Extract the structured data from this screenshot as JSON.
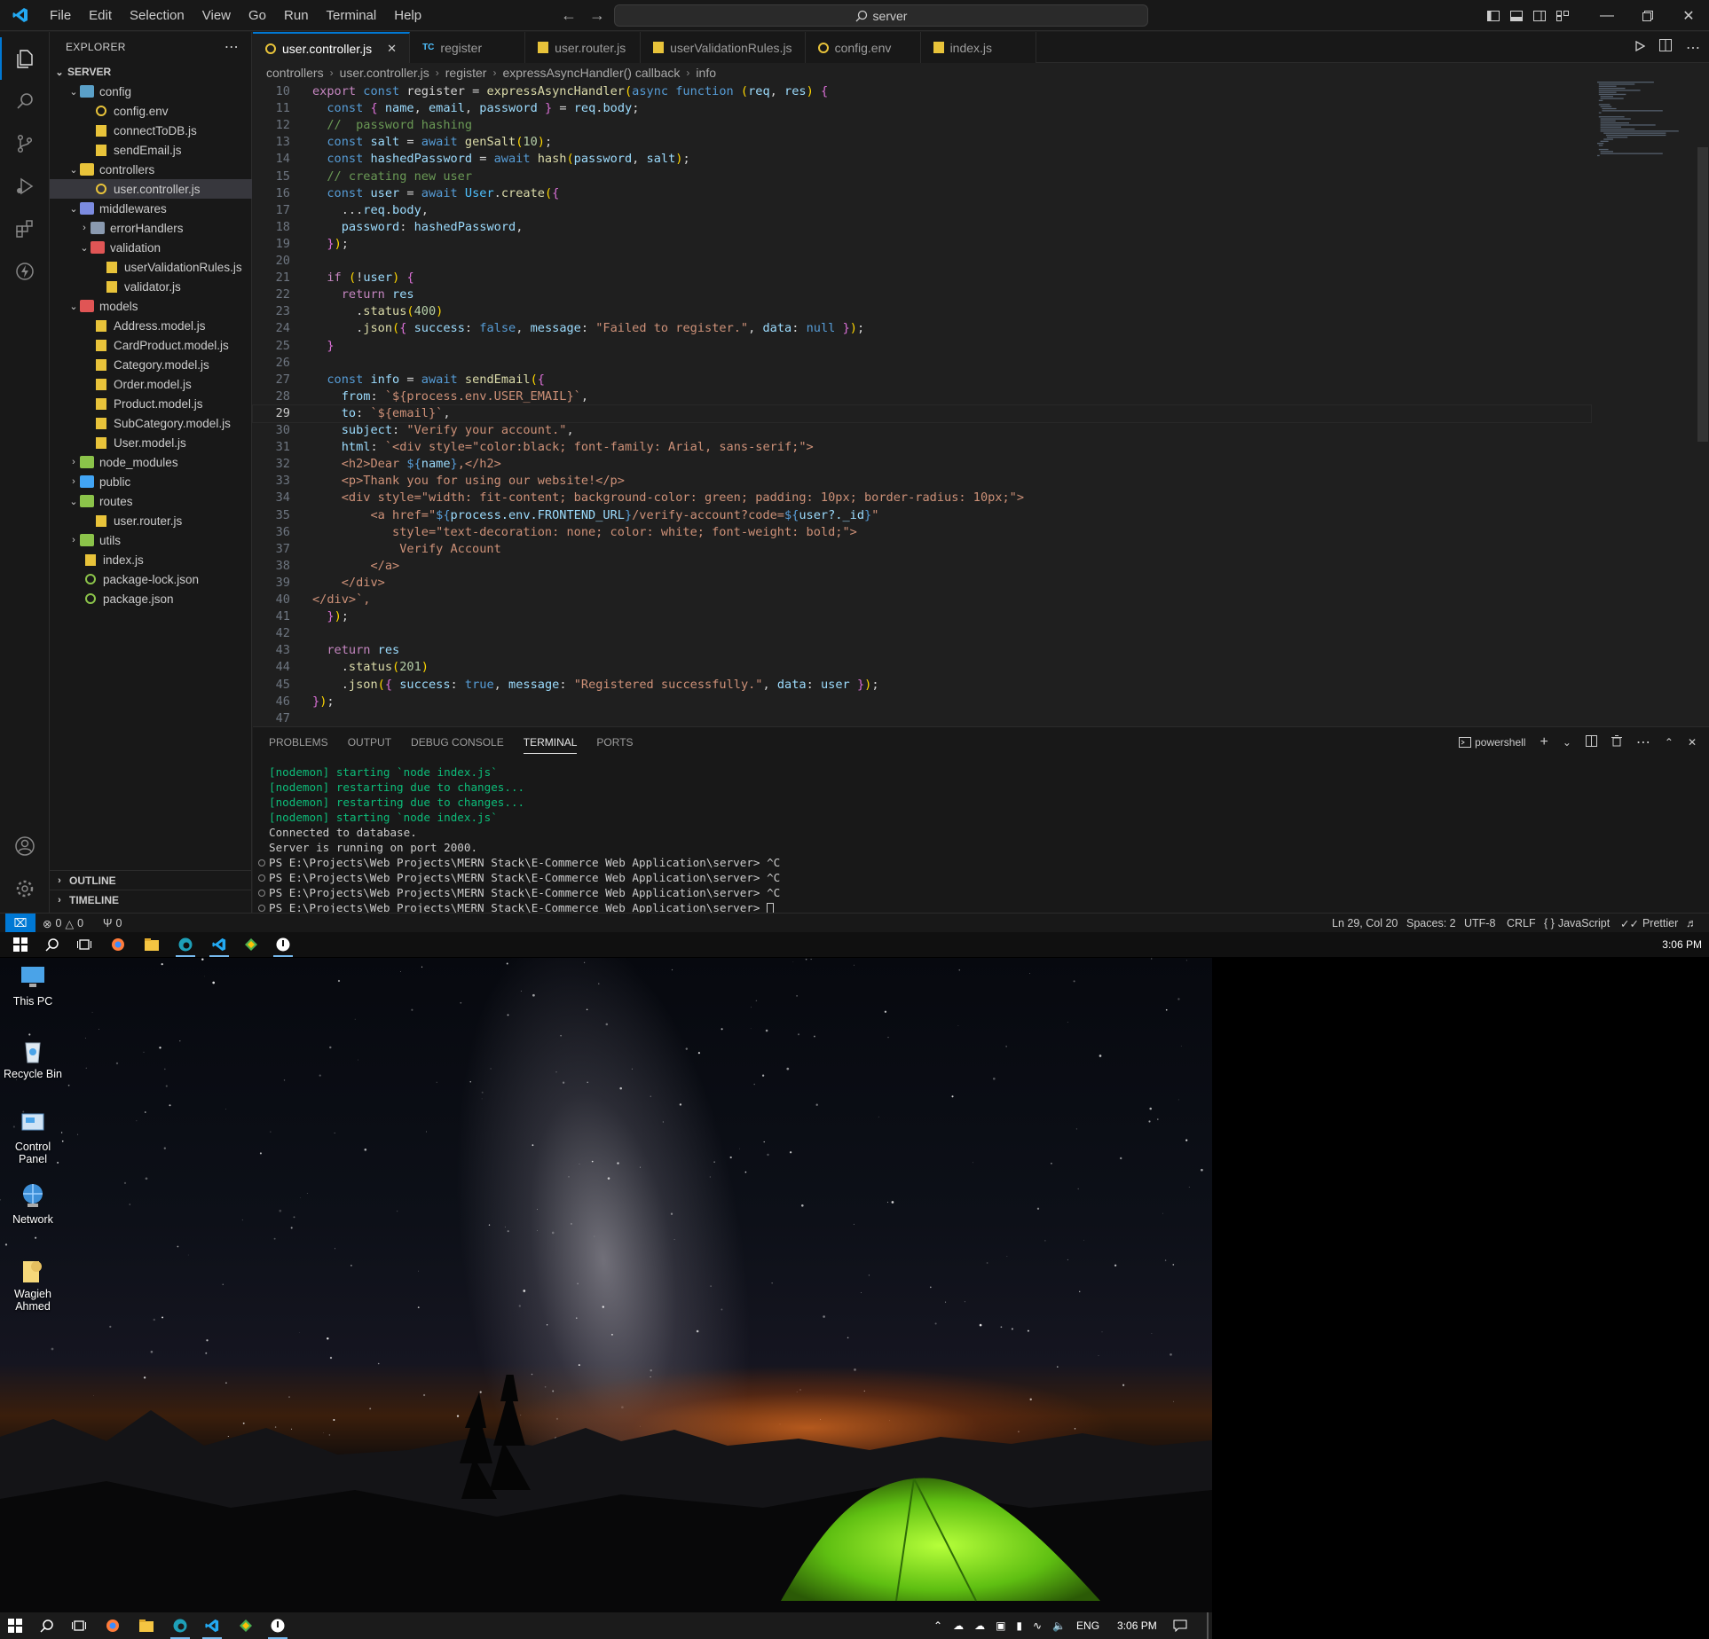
{
  "menu": [
    "File",
    "Edit",
    "Selection",
    "View",
    "Go",
    "Run",
    "Terminal",
    "Help"
  ],
  "command_center": "server",
  "explorer": {
    "title": "EXPLORER",
    "root": "SERVER",
    "tree": [
      {
        "label": "config",
        "type": "folder",
        "depth": 1,
        "open": true
      },
      {
        "label": "config.env",
        "type": "env",
        "depth": 2
      },
      {
        "label": "connectToDB.js",
        "type": "js",
        "depth": 2
      },
      {
        "label": "sendEmail.js",
        "type": "js",
        "depth": 2
      },
      {
        "label": "controllers",
        "type": "folder",
        "depth": 1,
        "open": true
      },
      {
        "label": "user.controller.js",
        "type": "gear",
        "depth": 2,
        "selected": true
      },
      {
        "label": "middlewares",
        "type": "folder",
        "depth": 1,
        "open": true
      },
      {
        "label": "errorHandlers",
        "type": "folder",
        "depth": 2,
        "open": false
      },
      {
        "label": "validation",
        "type": "folder",
        "depth": 2,
        "open": true
      },
      {
        "label": "userValidationRules.js",
        "type": "js",
        "depth": 3
      },
      {
        "label": "validator.js",
        "type": "js",
        "depth": 3
      },
      {
        "label": "models",
        "type": "folder",
        "depth": 1,
        "open": true
      },
      {
        "label": "Address.model.js",
        "type": "js",
        "depth": 2
      },
      {
        "label": "CardProduct.model.js",
        "type": "js",
        "depth": 2
      },
      {
        "label": "Category.model.js",
        "type": "js",
        "depth": 2
      },
      {
        "label": "Order.model.js",
        "type": "js",
        "depth": 2
      },
      {
        "label": "Product.model.js",
        "type": "js",
        "depth": 2
      },
      {
        "label": "SubCategory.model.js",
        "type": "js",
        "depth": 2
      },
      {
        "label": "User.model.js",
        "type": "js",
        "depth": 2
      },
      {
        "label": "node_modules",
        "type": "folder",
        "depth": 1,
        "open": false
      },
      {
        "label": "public",
        "type": "folder",
        "depth": 1,
        "open": false
      },
      {
        "label": "routes",
        "type": "folder",
        "depth": 1,
        "open": true
      },
      {
        "label": "user.router.js",
        "type": "js",
        "depth": 2
      },
      {
        "label": "utils",
        "type": "folder",
        "depth": 1,
        "open": false
      },
      {
        "label": "index.js",
        "type": "js",
        "depth": 1
      },
      {
        "label": "package-lock.json",
        "type": "json",
        "depth": 1
      },
      {
        "label": "package.json",
        "type": "json",
        "depth": 1
      }
    ],
    "outline": "OUTLINE",
    "timeline": "TIMELINE"
  },
  "tabs": [
    {
      "label": "user.controller.js",
      "icon": "gear",
      "active": true
    },
    {
      "label": "register",
      "icon": "TC"
    },
    {
      "label": "user.router.js",
      "icon": "js"
    },
    {
      "label": "userValidationRules.js",
      "icon": "js"
    },
    {
      "label": "config.env",
      "icon": "gear"
    },
    {
      "label": "index.js",
      "icon": "js"
    }
  ],
  "breadcrumbs": [
    "controllers",
    "user.controller.js",
    "register",
    "expressAsyncHandler() callback",
    "info"
  ],
  "code": {
    "first_line": 10,
    "current_line": 29,
    "lines": [
      "export const register = expressAsyncHandler(async function (req, res) {",
      "  const { name, email, password } = req.body;",
      "  //  password hashing",
      "  const salt = await genSalt(10);",
      "  const hashedPassword = await hash(password, salt);",
      "  // creating new user",
      "  const user = await User.create({",
      "    ...req.body,",
      "    password: hashedPassword,",
      "  });",
      "",
      "  if (!user) {",
      "    return res",
      "      .status(400)",
      "      .json({ success: false, message: \"Failed to register.\", data: null });",
      "  }",
      "",
      "  const info = await sendEmail({",
      "    from: `${process.env.USER_EMAIL}`,",
      "    to: `${email}`,",
      "    subject: \"Verify your account.\",",
      "    html: `<div style=\"color:black; font-family: Arial, sans-serif;\">",
      "    <h2>Dear ${name},</h2>",
      "    <p>Thank you for using our website!</p>",
      "    <div style=\"width: fit-content; background-color: green; padding: 10px; border-radius: 10px;\">",
      "        <a href=\"${process.env.FRONTEND_URL}/verify-account?code=${user?._id}\"",
      "           style=\"text-decoration: none; color: white; font-weight: bold;\">",
      "            Verify Account",
      "        </a>",
      "    </div>",
      "</div>`,",
      "  });",
      "",
      "  return res",
      "    .status(201)",
      "    .json({ success: true, message: \"Registered successfully.\", data: user });",
      "});",
      ""
    ]
  },
  "panel": {
    "tabs": [
      "PROBLEMS",
      "OUTPUT",
      "DEBUG CONSOLE",
      "TERMINAL",
      "PORTS"
    ],
    "active_tab": "TERMINAL",
    "shell": "powershell",
    "lines": [
      {
        "text": "[nodemon] starting `node index.js`",
        "green": true
      },
      {
        "text": "[nodemon] restarting due to changes...",
        "green": true
      },
      {
        "text": "[nodemon] restarting due to changes...",
        "green": true
      },
      {
        "text": "[nodemon] starting `node index.js`",
        "green": true
      },
      {
        "text": "Connected to database."
      },
      {
        "text": "Server is running on port 2000."
      },
      {
        "text": "PS E:\\Projects\\Web Projects\\MERN Stack\\E-Commerce Web Application\\server> ^C",
        "dot": true
      },
      {
        "text": "PS E:\\Projects\\Web Projects\\MERN Stack\\E-Commerce Web Application\\server> ^C",
        "dot": true
      },
      {
        "text": "PS E:\\Projects\\Web Projects\\MERN Stack\\E-Commerce Web Application\\server> ^C",
        "dot": true
      },
      {
        "text": "PS E:\\Projects\\Web Projects\\MERN Stack\\E-Commerce Web Application\\server> ",
        "dot": true,
        "cursor": true
      }
    ]
  },
  "status": {
    "errors": "0",
    "warnings": "0",
    "ports": "0",
    "position": "Ln 29, Col 20",
    "spaces": "Spaces: 2",
    "encoding": "UTF-8",
    "eol": "CRLF",
    "language": "JavaScript",
    "formatter": "Prettier"
  },
  "clock_top": "3:06 PM",
  "desktop_icons": [
    "This PC",
    "Recycle Bin",
    "Control Panel",
    "Network",
    "Wagieh Ahmed"
  ],
  "taskbar": {
    "lang": "ENG",
    "time": "3:06 PM"
  },
  "colors": {
    "accent": "#0078d4",
    "editor_bg": "#1f1f1f",
    "chrome_bg": "#181818",
    "terminal_green": "#0dbc79"
  }
}
